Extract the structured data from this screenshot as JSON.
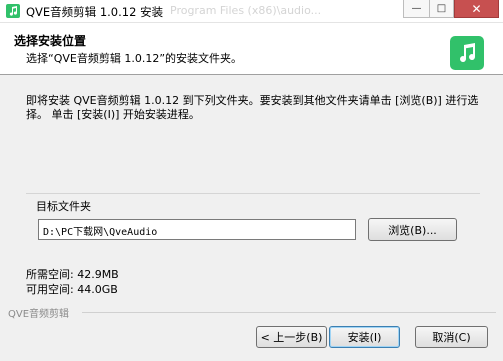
{
  "window": {
    "title": "QVE音频剪辑 1.0.12 安装",
    "background_title": "Program Files (x86)\\audio...",
    "minimize_icon": "minimize-icon",
    "maximize_icon": "maximize-icon",
    "close_icon": "close-icon"
  },
  "header": {
    "title": "选择安装位置",
    "subtitle": "选择“QVE音频剪辑 1.0.12”的安装文件夹。",
    "logo_icon": "music-note-icon",
    "logo_color": "#31c16a"
  },
  "intro_text": "即将安装 QVE音频剪辑 1.0.12 到下列文件夹。要安装到其他文件夹请单击 [浏览(B)] 进行选择。 单击 [安装(I)] 开始安装进程。",
  "destination": {
    "label": "目标文件夹",
    "path": "D:\\PC下载网\\QveAudio",
    "browse_label": "浏览(B)..."
  },
  "space": {
    "required": "所需空间: 42.9MB",
    "available": "可用空间: 44.0GB"
  },
  "footer": {
    "brand": "QVE音频剪辑",
    "back_label": "< 上一步(B)",
    "install_label": "安装(I)",
    "cancel_label": "取消(C)"
  }
}
